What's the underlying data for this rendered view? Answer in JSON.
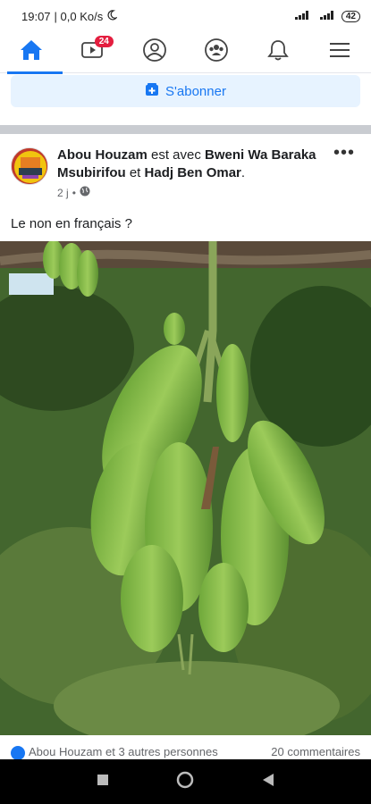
{
  "status": {
    "time": "19:07",
    "net_speed": "| 0,0 Ko/s",
    "battery": "42"
  },
  "nav": {
    "video_badge": "24",
    "items": [
      "home-icon",
      "video-icon",
      "profile-icon",
      "groups-icon",
      "notifications-icon",
      "menu-icon"
    ]
  },
  "subscribe": {
    "label": "S'abonner"
  },
  "post": {
    "author": "Abou Houzam",
    "with_text": " est avec ",
    "tagged1": "Bweni Wa Baraka Msubirifou",
    "and_text": " et ",
    "tagged2": "Hadj Ben Omar",
    "period": ".",
    "time": "2 j",
    "separator": "•",
    "privacy_icon": "globe-icon",
    "text": "Le non en français ?",
    "reactions_text": "Abou Houzam et 3 autres personnes",
    "comments_text": "20 commentaires"
  },
  "colors": {
    "accent": "#1877f2",
    "badge": "#e41e3f",
    "subscribe_bg": "#e7f3ff"
  }
}
